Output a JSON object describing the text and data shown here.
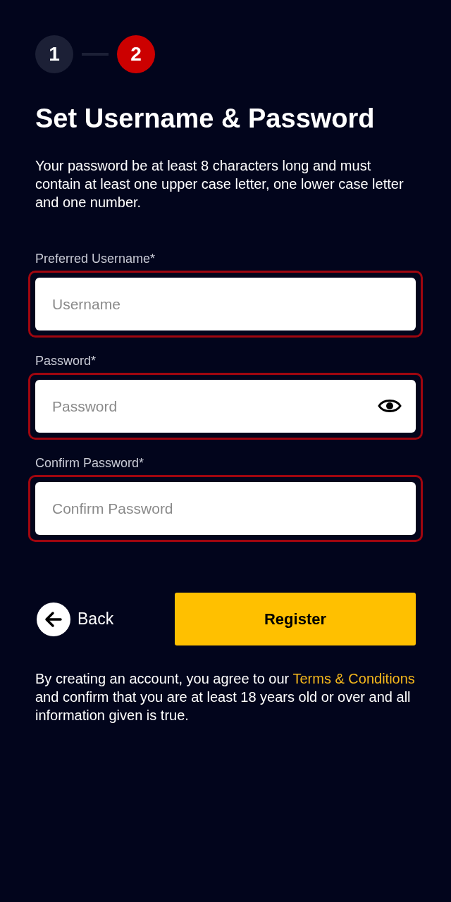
{
  "steps": [
    {
      "label": "1",
      "selected": false
    },
    {
      "label": "2",
      "selected": true
    }
  ],
  "title": "Set Username & Password",
  "description": "Your password be at least 8 characters long and must contain at least one upper case letter, one lower case letter and one number.",
  "fields": [
    {
      "label": "Preferred Username*",
      "placeholder": "Username",
      "invalid": true,
      "reveal_toggle": false
    },
    {
      "label": "Password*",
      "placeholder": "Password",
      "invalid": true,
      "reveal_toggle": true
    },
    {
      "label": "Confirm Password*",
      "placeholder": "Confirm Password",
      "invalid": true,
      "reveal_toggle": false
    }
  ],
  "back_button": "Back",
  "register_button": "Register",
  "terms": {
    "before": "By creating an account, you agree to our",
    "link": "Terms & Conditions",
    "after": "and confirm that you are at least 18 years old or over and all information given is true."
  }
}
